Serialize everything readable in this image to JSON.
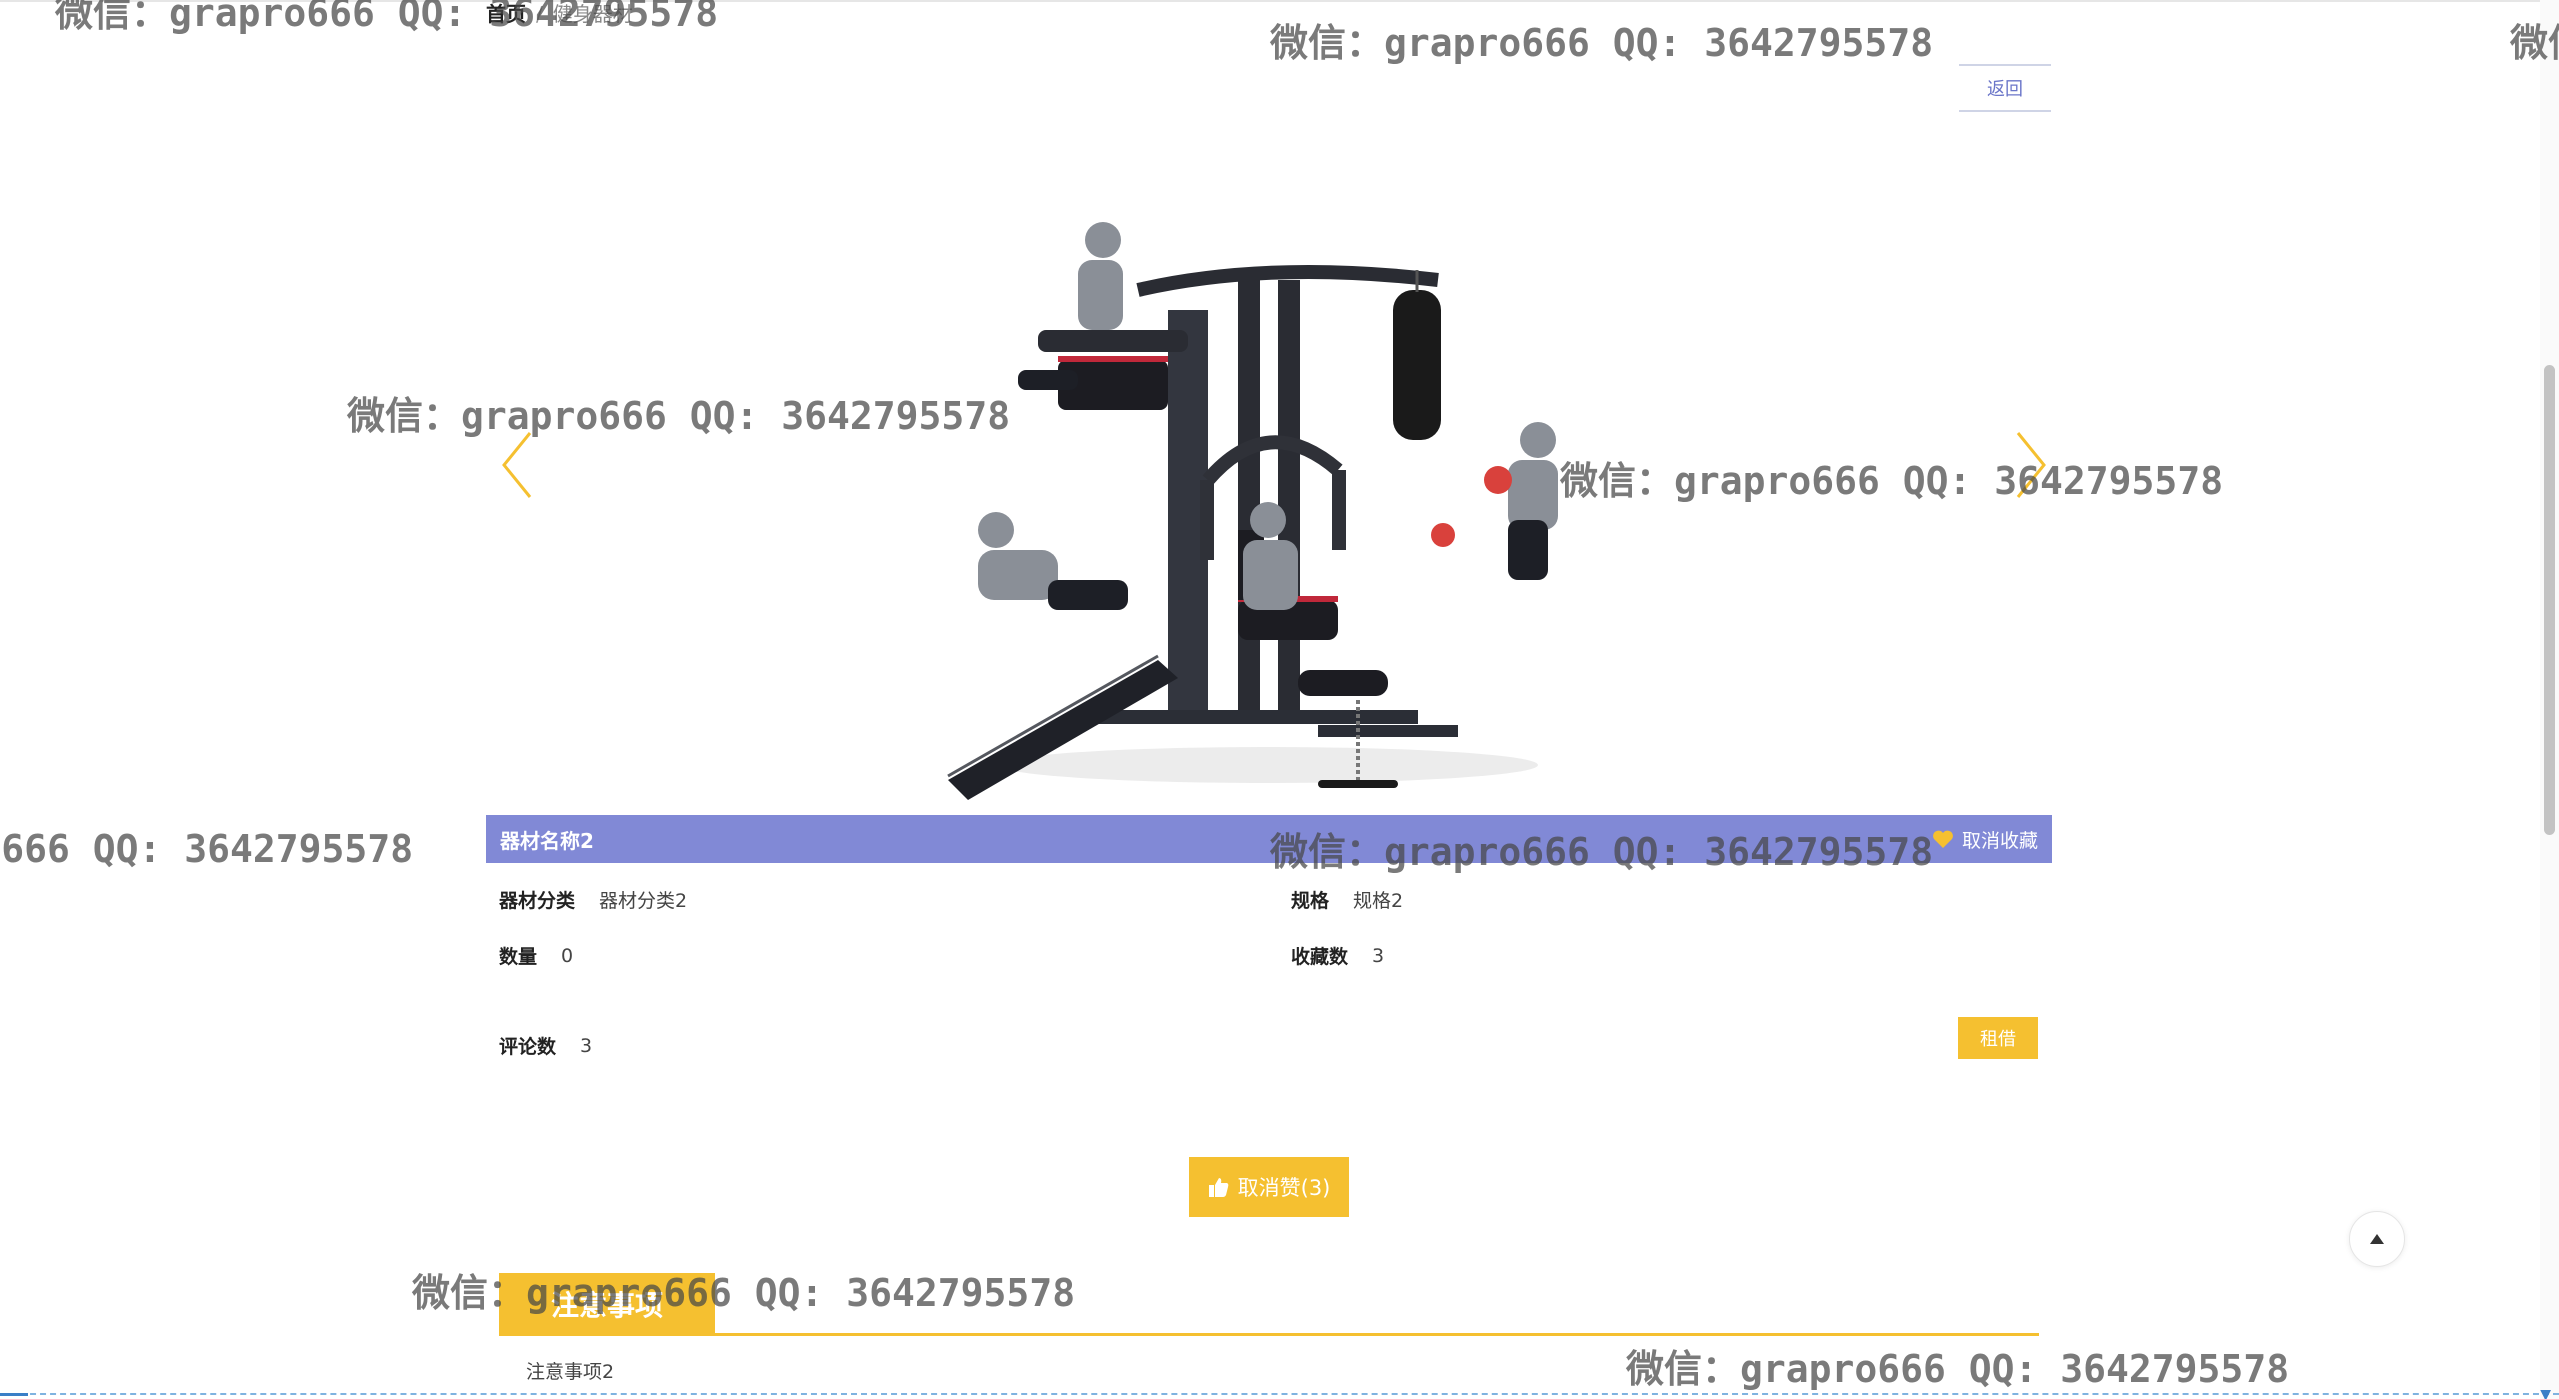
{
  "breadcrumb": {
    "home": "首页",
    "separator": "/",
    "current": "健身器材"
  },
  "back_button": "返回",
  "carousel": {
    "prev_icon": "chevron-left-icon",
    "next_icon": "chevron-right-icon",
    "image_icon": "gym-equipment-image"
  },
  "equipment": {
    "name": "器材名称2",
    "favorite_label": "取消收藏",
    "category_label": "器材分类",
    "category_value": "器材分类2",
    "spec_label": "规格",
    "spec_value": "规格2",
    "quantity_label": "数量",
    "quantity_value": "0",
    "favorites_label": "收藏数",
    "favorites_value": "3",
    "comments_label": "评论数",
    "comments_value": "3"
  },
  "rent_button": "租借",
  "like_button": "取消赞(3)",
  "notes": {
    "header": "注意事项",
    "content": "注意事项2"
  },
  "watermark": "微信：grapro666 QQ: 3642795578",
  "colors": {
    "accent_yellow": "#f5c030",
    "title_bar_purple": "#8189d6",
    "link_blue": "#6b76c9"
  }
}
